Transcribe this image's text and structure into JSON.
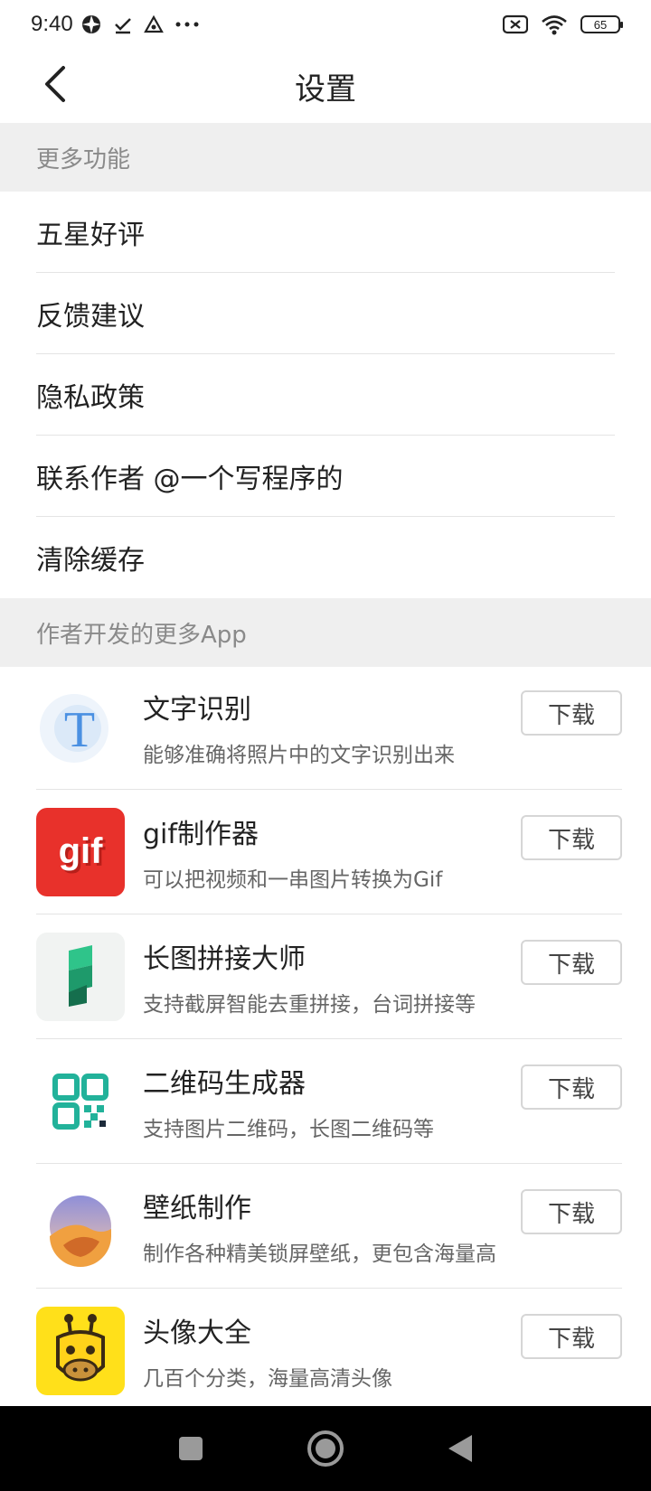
{
  "status_bar": {
    "time": "9:40",
    "battery": "65"
  },
  "header": {
    "title": "设置"
  },
  "sections": {
    "more_features": {
      "title": "更多功能",
      "items": [
        {
          "label": "五星好评"
        },
        {
          "label": "反馈建议"
        },
        {
          "label": "隐私政策"
        },
        {
          "label": "联系作者 @一个写程序的"
        },
        {
          "label": "清除缓存"
        }
      ]
    },
    "more_apps": {
      "title": "作者开发的更多App",
      "apps": [
        {
          "name": "文字识别",
          "desc": "能够准确将照片中的文字识别出来",
          "button": "下载",
          "icon": "text-recognition-icon"
        },
        {
          "name": "gif制作器",
          "desc": "可以把视频和一串图片转换为Gif",
          "button": "下载",
          "icon": "gif-maker-icon",
          "icon_text": "gif"
        },
        {
          "name": "长图拼接大师",
          "desc": "支持截屏智能去重拼接，台词拼接等",
          "button": "下载",
          "icon": "long-image-stitch-icon"
        },
        {
          "name": "二维码生成器",
          "desc": "支持图片二维码，长图二维码等",
          "button": "下载",
          "icon": "qr-code-icon"
        },
        {
          "name": "壁纸制作",
          "desc": "制作各种精美锁屏壁纸，更包含海量高",
          "button": "下载",
          "icon": "wallpaper-icon"
        },
        {
          "name": "头像大全",
          "desc": "几百个分类，海量高清头像",
          "button": "下载",
          "icon": "giraffe-avatar-icon"
        }
      ]
    }
  },
  "colors": {
    "section_bg": "#efefef",
    "section_text": "#8a8a8a",
    "gif_red": "#e8312b",
    "qr_teal": "#22b29a",
    "avatar_yellow": "#ffe01a"
  }
}
